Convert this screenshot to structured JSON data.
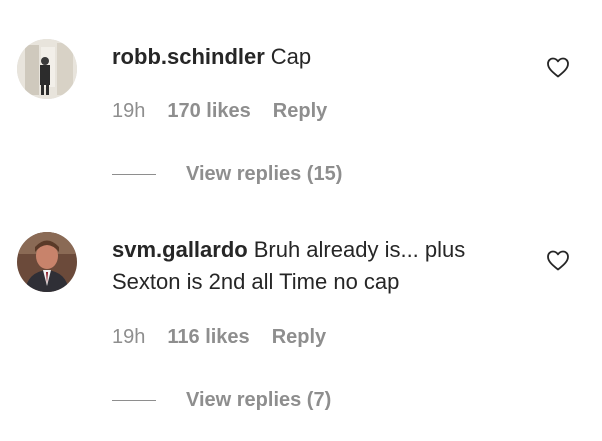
{
  "comments": [
    {
      "username": "robb.schindler",
      "text": "Cap",
      "time": "19h",
      "likes": "170 likes",
      "reply_label": "Reply",
      "view_replies": "View replies (15)"
    },
    {
      "username": "svm.gallardo",
      "text": "Bruh already is... plus Sexton is 2nd all Time no cap",
      "time": "19h",
      "likes": "116 likes",
      "reply_label": "Reply",
      "view_replies": "View replies (7)"
    }
  ],
  "icons": {
    "like": "heart-outline-icon"
  },
  "colors": {
    "text": "#262626",
    "secondary": "#8e8e8e",
    "background": "#ffffff"
  }
}
